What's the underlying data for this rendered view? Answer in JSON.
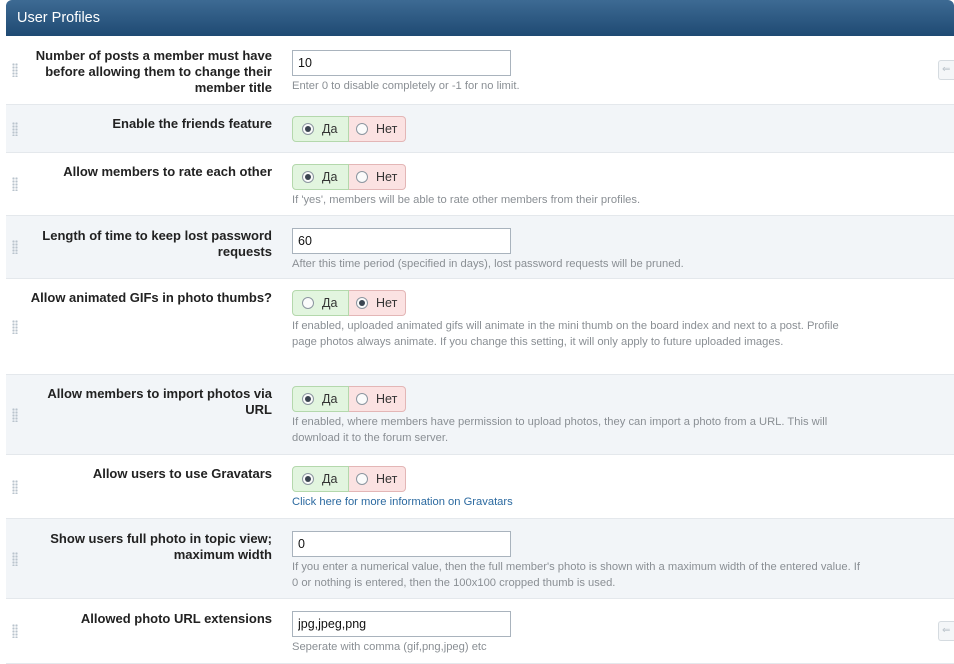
{
  "header": {
    "title": "User Profiles"
  },
  "yes_label": "Да",
  "no_label": "Нет",
  "rows": [
    {
      "label": "Number of posts a member must have before allowing them to change their member title",
      "value": "10",
      "desc": "Enter 0 to disable completely or -1 for no limit."
    },
    {
      "label": "Enable the friends feature",
      "selected": "yes"
    },
    {
      "label": "Allow members to rate each other",
      "selected": "yes",
      "desc": "If 'yes', members will be able to rate other members from their profiles."
    },
    {
      "label": "Length of time to keep lost password requests",
      "value": "60",
      "desc": "After this time period (specified in days), lost password requests will be pruned."
    },
    {
      "label": "Allow animated GIFs in photo thumbs?",
      "selected": "no",
      "desc": "If enabled, uploaded animated gifs will animate in the mini thumb on the board index and next to a post. Profile page photos always animate. If you change this setting, it will only apply to future uploaded images."
    },
    {
      "label": "Allow members to import photos via URL",
      "selected": "yes",
      "desc": "If enabled, where members have permission to upload photos, they can import a photo from a URL. This will download it to the forum server."
    },
    {
      "label": "Allow users to use Gravatars",
      "selected": "yes",
      "link": "Click here for more information on Gravatars"
    },
    {
      "label": "Show users full photo in topic view; maximum width",
      "value": "0",
      "desc": "If you enter a numerical value, then the full member's photo is shown with a maximum width of the entered value. If 0 or nothing is entered, then the 100x100 cropped thumb is used."
    },
    {
      "label": "Allowed photo URL extensions",
      "value": "jpg,jpeg,png",
      "desc": "Seperate with comma (gif,png,jpeg) etc"
    }
  ],
  "icons": {
    "drag_handle": "drag-handle-icon",
    "side_tab": "revert-icon"
  }
}
